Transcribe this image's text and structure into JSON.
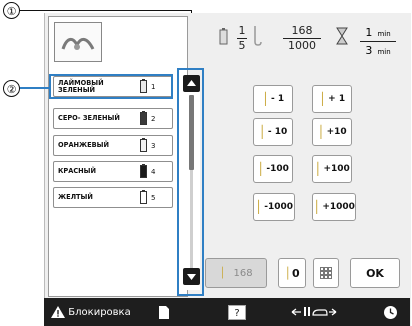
{
  "callouts": [
    "①",
    "②"
  ],
  "thread_list": [
    {
      "name": "ЛАЙМОВЫЙ ЗЕЛЕНЫЙ",
      "number": "1",
      "color": "#e8e8e8"
    },
    {
      "name": "СЕРО- ЗЕЛЕНЫЙ",
      "number": "2",
      "color": "#3a3a3a"
    },
    {
      "name": "ОРАНЖЕВЫЙ",
      "number": "3",
      "color": "#f2f2f2"
    },
    {
      "name": "КРАСНЫЙ",
      "number": "4",
      "color": "#1a1a1a"
    },
    {
      "name": "ЖЕЛТЫЙ",
      "number": "5",
      "color": "#ffffff"
    }
  ],
  "progress": {
    "color_current": "1",
    "color_total": "5",
    "stitch_current": "168",
    "stitch_total": "1000",
    "time_current": "1",
    "time_total": "3",
    "time_unit": "min"
  },
  "step_buttons": [
    "- 1",
    "+ 1",
    "- 10",
    "+10",
    "-100",
    "+100",
    "-1000",
    "+1000"
  ],
  "bottom": {
    "stitch_value": "168",
    "zero_label": "0",
    "ok_label": "OK"
  },
  "taskbar": {
    "lock_label": "Блокировка"
  },
  "colors": {
    "accent_blue": "#2f7fc4",
    "taskbar": "#1e1e1e"
  }
}
